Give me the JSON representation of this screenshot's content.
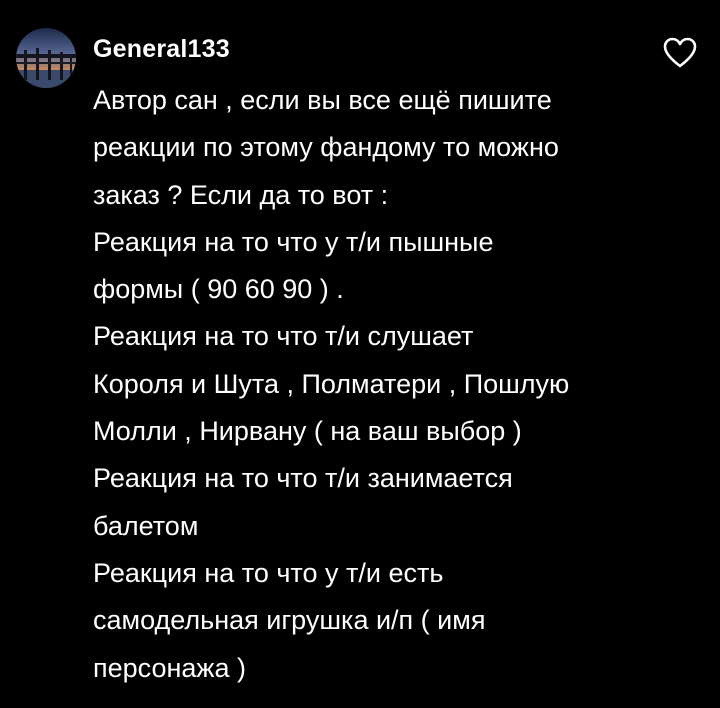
{
  "comment": {
    "username": "General133",
    "avatar": {
      "icon": "avatar-bridge-sunset-icon"
    },
    "like_icon": "heart-outline-icon",
    "lines": [
      "Автор сан , если вы все ещё пишите",
      "реакции по этому фандому то можно",
      "заказ ? Если да то вот :",
      "Реакция на то что у т/и пышные",
      "формы ( 90 60 90 ) .",
      "Реакция на то что т/и слушает",
      "Короля и Шута , Полматери , Пошлую",
      "Молли , Нирвану ( на ваш выбор )",
      "Реакция на то что т/и занимается",
      "балетом",
      "Реакция на то что у т/и есть",
      "самодельная игрушка и/п ( имя",
      "персонажа )"
    ]
  },
  "colors": {
    "background": "#000000",
    "text": "#ffffff"
  }
}
